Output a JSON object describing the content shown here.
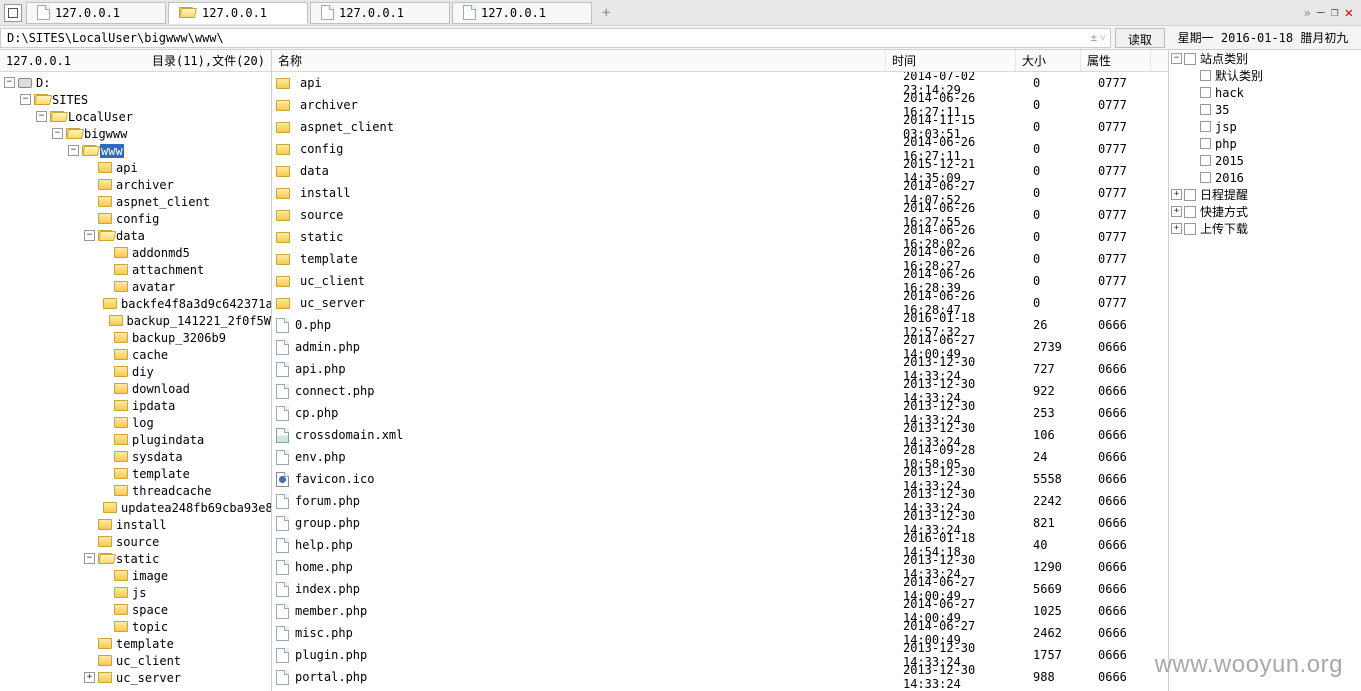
{
  "tabs": [
    {
      "label": "127.0.0.1",
      "active": false,
      "iconType": "page"
    },
    {
      "label": "127.0.0.1",
      "active": true,
      "iconType": "folder"
    },
    {
      "label": "127.0.0.1",
      "active": false,
      "iconType": "page"
    },
    {
      "label": "127.0.0.1",
      "active": false,
      "iconType": "page"
    }
  ],
  "path_bar": {
    "path": "D:\\SITES\\LocalUser\\bigwww\\www\\",
    "read_btn": "读取",
    "date_info": "星期一 2016-01-18 腊月初九"
  },
  "left_header": {
    "host": "127.0.0.1",
    "summary": "目录(11),文件(20)"
  },
  "tree": [
    {
      "depth": 0,
      "toggle": "-",
      "icon": "disk",
      "label": "D:"
    },
    {
      "depth": 1,
      "toggle": "-",
      "icon": "folder-open",
      "label": "SITES"
    },
    {
      "depth": 2,
      "toggle": "-",
      "icon": "folder-open",
      "label": "LocalUser"
    },
    {
      "depth": 3,
      "toggle": "-",
      "icon": "folder-open",
      "label": "bigwww"
    },
    {
      "depth": 4,
      "toggle": "-",
      "icon": "folder-open",
      "label": "www",
      "selected": true
    },
    {
      "depth": 5,
      "toggle": "",
      "icon": "folder",
      "label": "api"
    },
    {
      "depth": 5,
      "toggle": "",
      "icon": "folder",
      "label": "archiver"
    },
    {
      "depth": 5,
      "toggle": "",
      "icon": "folder",
      "label": "aspnet_client"
    },
    {
      "depth": 5,
      "toggle": "",
      "icon": "folder",
      "label": "config"
    },
    {
      "depth": 5,
      "toggle": "-",
      "icon": "folder-open",
      "label": "data"
    },
    {
      "depth": 6,
      "toggle": "",
      "icon": "folder",
      "label": "addonmd5"
    },
    {
      "depth": 6,
      "toggle": "",
      "icon": "folder",
      "label": "attachment"
    },
    {
      "depth": 6,
      "toggle": "",
      "icon": "folder",
      "label": "avatar"
    },
    {
      "depth": 6,
      "toggle": "",
      "icon": "folder",
      "label": "backfe4f8a3d9c642371a"
    },
    {
      "depth": 6,
      "toggle": "",
      "icon": "folder",
      "label": "backup_141221_2f0f5W"
    },
    {
      "depth": 6,
      "toggle": "",
      "icon": "folder",
      "label": "backup_3206b9"
    },
    {
      "depth": 6,
      "toggle": "",
      "icon": "folder",
      "label": "cache"
    },
    {
      "depth": 6,
      "toggle": "",
      "icon": "folder",
      "label": "diy"
    },
    {
      "depth": 6,
      "toggle": "",
      "icon": "folder",
      "label": "download"
    },
    {
      "depth": 6,
      "toggle": "",
      "icon": "folder",
      "label": "ipdata"
    },
    {
      "depth": 6,
      "toggle": "",
      "icon": "folder",
      "label": "log"
    },
    {
      "depth": 6,
      "toggle": "",
      "icon": "folder",
      "label": "plugindata"
    },
    {
      "depth": 6,
      "toggle": "",
      "icon": "folder",
      "label": "sysdata"
    },
    {
      "depth": 6,
      "toggle": "",
      "icon": "folder",
      "label": "template"
    },
    {
      "depth": 6,
      "toggle": "",
      "icon": "folder",
      "label": "threadcache"
    },
    {
      "depth": 6,
      "toggle": "",
      "icon": "folder",
      "label": "updatea248fb69cba93e8"
    },
    {
      "depth": 5,
      "toggle": "",
      "icon": "folder",
      "label": "install"
    },
    {
      "depth": 5,
      "toggle": "",
      "icon": "folder",
      "label": "source"
    },
    {
      "depth": 5,
      "toggle": "-",
      "icon": "folder-open",
      "label": "static"
    },
    {
      "depth": 6,
      "toggle": "",
      "icon": "folder",
      "label": "image"
    },
    {
      "depth": 6,
      "toggle": "",
      "icon": "folder",
      "label": "js"
    },
    {
      "depth": 6,
      "toggle": "",
      "icon": "folder",
      "label": "space"
    },
    {
      "depth": 6,
      "toggle": "",
      "icon": "folder",
      "label": "topic"
    },
    {
      "depth": 5,
      "toggle": "",
      "icon": "folder",
      "label": "template"
    },
    {
      "depth": 5,
      "toggle": "",
      "icon": "folder",
      "label": "uc_client"
    },
    {
      "depth": 5,
      "toggle": "+",
      "icon": "folder",
      "label": "uc_server"
    }
  ],
  "columns": {
    "name": "名称",
    "time": "时间",
    "size": "大小",
    "attr": "属性"
  },
  "files": [
    {
      "type": "folder",
      "name": "api",
      "time": "2014-07-02 23:14:29",
      "size": "0",
      "attr": "0777"
    },
    {
      "type": "folder",
      "name": "archiver",
      "time": "2014-06-26 16:27:11",
      "size": "0",
      "attr": "0777"
    },
    {
      "type": "folder",
      "name": "aspnet_client",
      "time": "2014-11-15 03:03:51",
      "size": "0",
      "attr": "0777"
    },
    {
      "type": "folder",
      "name": "config",
      "time": "2014-06-26 16:27:11",
      "size": "0",
      "attr": "0777"
    },
    {
      "type": "folder",
      "name": "data",
      "time": "2015-12-21 14:35:09",
      "size": "0",
      "attr": "0777"
    },
    {
      "type": "folder",
      "name": "install",
      "time": "2014-06-27 14:07:52",
      "size": "0",
      "attr": "0777"
    },
    {
      "type": "folder",
      "name": "source",
      "time": "2014-06-26 16:27:55",
      "size": "0",
      "attr": "0777"
    },
    {
      "type": "folder",
      "name": "static",
      "time": "2014-06-26 16:28:02",
      "size": "0",
      "attr": "0777"
    },
    {
      "type": "folder",
      "name": "template",
      "time": "2014-06-26 16:28:27",
      "size": "0",
      "attr": "0777"
    },
    {
      "type": "folder",
      "name": "uc_client",
      "time": "2014-06-26 16:28:39",
      "size": "0",
      "attr": "0777"
    },
    {
      "type": "folder",
      "name": "uc_server",
      "time": "2014-06-26 16:28:47",
      "size": "0",
      "attr": "0777"
    },
    {
      "type": "file",
      "name": "0.php",
      "time": "2016-01-18 12:57:32",
      "size": "26",
      "attr": "0666"
    },
    {
      "type": "file",
      "name": "admin.php",
      "time": "2014-06-27 14:00:49",
      "size": "2739",
      "attr": "0666"
    },
    {
      "type": "file",
      "name": "api.php",
      "time": "2013-12-30 14:33:24",
      "size": "727",
      "attr": "0666"
    },
    {
      "type": "file",
      "name": "connect.php",
      "time": "2013-12-30 14:33:24",
      "size": "922",
      "attr": "0666"
    },
    {
      "type": "file",
      "name": "cp.php",
      "time": "2013-12-30 14:33:24",
      "size": "253",
      "attr": "0666"
    },
    {
      "type": "img",
      "name": "crossdomain.xml",
      "time": "2013-12-30 14:33:24",
      "size": "106",
      "attr": "0666"
    },
    {
      "type": "file",
      "name": "env.php",
      "time": "2014-09-28 10:58:05",
      "size": "24",
      "attr": "0666"
    },
    {
      "type": "ico",
      "name": "favicon.ico",
      "time": "2013-12-30 14:33:24",
      "size": "5558",
      "attr": "0666"
    },
    {
      "type": "file",
      "name": "forum.php",
      "time": "2013-12-30 14:33:24",
      "size": "2242",
      "attr": "0666"
    },
    {
      "type": "file",
      "name": "group.php",
      "time": "2013-12-30 14:33:24",
      "size": "821",
      "attr": "0666"
    },
    {
      "type": "file",
      "name": "help.php",
      "time": "2016-01-18 14:54:18",
      "size": "40",
      "attr": "0666"
    },
    {
      "type": "file",
      "name": "home.php",
      "time": "2013-12-30 14:33:24",
      "size": "1290",
      "attr": "0666"
    },
    {
      "type": "file",
      "name": "index.php",
      "time": "2014-06-27 14:00:49",
      "size": "5669",
      "attr": "0666"
    },
    {
      "type": "file",
      "name": "member.php",
      "time": "2014-06-27 14:00:49",
      "size": "1025",
      "attr": "0666"
    },
    {
      "type": "file",
      "name": "misc.php",
      "time": "2014-06-27 14:00:49",
      "size": "2462",
      "attr": "0666"
    },
    {
      "type": "file",
      "name": "plugin.php",
      "time": "2013-12-30 14:33:24",
      "size": "1757",
      "attr": "0666"
    },
    {
      "type": "file",
      "name": "portal.php",
      "time": "2013-12-30 14:33:24",
      "size": "988",
      "attr": "0666"
    }
  ],
  "right_tree": [
    {
      "depth": 0,
      "toggle": "-",
      "type": "root",
      "label": "站点类别"
    },
    {
      "depth": 1,
      "toggle": "",
      "type": "chk",
      "label": "默认类别"
    },
    {
      "depth": 1,
      "toggle": "",
      "type": "chk",
      "label": "hack"
    },
    {
      "depth": 1,
      "toggle": "",
      "type": "chk",
      "label": "35"
    },
    {
      "depth": 1,
      "toggle": "",
      "type": "chk",
      "label": "jsp"
    },
    {
      "depth": 1,
      "toggle": "",
      "type": "chk",
      "label": "php"
    },
    {
      "depth": 1,
      "toggle": "",
      "type": "chk",
      "label": "2015"
    },
    {
      "depth": 1,
      "toggle": "",
      "type": "chk",
      "label": "2016"
    },
    {
      "depth": 0,
      "toggle": "+",
      "type": "ico",
      "label": "日程提醒"
    },
    {
      "depth": 0,
      "toggle": "+",
      "type": "ico",
      "label": "快捷方式"
    },
    {
      "depth": 0,
      "toggle": "+",
      "type": "ico",
      "label": "上传下载"
    }
  ],
  "watermark": "www.wooyun.org"
}
